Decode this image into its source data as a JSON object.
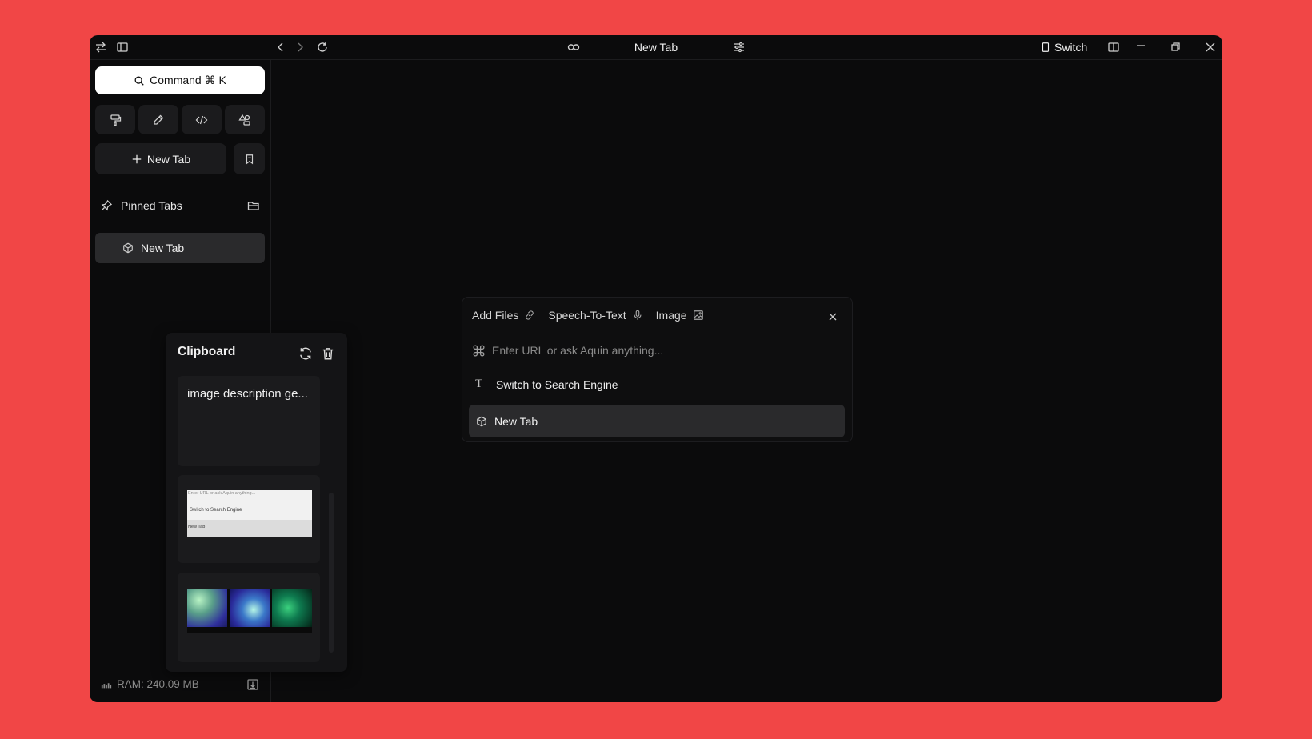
{
  "window": {
    "title": "New Tab",
    "switch_label": "Switch"
  },
  "sidebar": {
    "command_label": "Command ⌘ K",
    "new_tab_label": "New Tab",
    "pinned_label": "Pinned Tabs",
    "tabs": [
      {
        "label": "New Tab",
        "icon": "cube-icon"
      }
    ],
    "ram_text": "RAM: 240.09 MB"
  },
  "clipboard": {
    "title": "Clipboard",
    "items": [
      {
        "type": "text",
        "text": "image description ge..."
      },
      {
        "type": "image",
        "shot_lines": [
          "Enter URL or ask Aquin anything...",
          "Switch to Search Engine",
          "New Tab"
        ]
      },
      {
        "type": "image",
        "description": "gradient thumbnails"
      }
    ]
  },
  "palette": {
    "tools": [
      {
        "label": "Add Files",
        "icon": "link-icon"
      },
      {
        "label": "Speech-To-Text",
        "icon": "mic-icon"
      },
      {
        "label": "Image",
        "icon": "image-icon"
      }
    ],
    "input_placeholder": "Enter URL or ask Aquin anything...",
    "input_value": "",
    "items": [
      {
        "label": "Switch to Search Engine",
        "icon": "text-icon",
        "glyph": "T"
      },
      {
        "label": "New Tab",
        "icon": "cube-icon",
        "selected": true
      }
    ]
  },
  "colors": {
    "background": "#f14646",
    "window": "#0b0b0c",
    "panel": "#1b1b1d",
    "selected": "#2a2a2c"
  }
}
